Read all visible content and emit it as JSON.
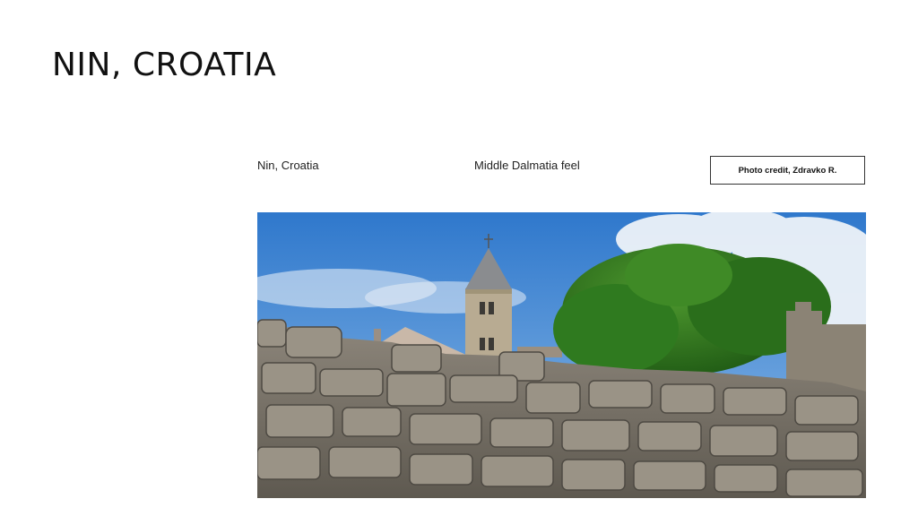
{
  "slide": {
    "title": "NIN, CROATIA",
    "location_label": "Nin, Croatia",
    "feel_label": "Middle Dalmatia feel",
    "photo_credit": "Photo credit, Zdravko R."
  },
  "photo": {
    "subject": "stone wall with church bell tower and tree",
    "colors": {
      "sky": "#4a8fd6",
      "cloud": "#eef3f8",
      "tree": "#2f7a1f",
      "tower": "#b8ab92",
      "roof": "#8a8c8f",
      "wall": "#7d776c"
    }
  }
}
